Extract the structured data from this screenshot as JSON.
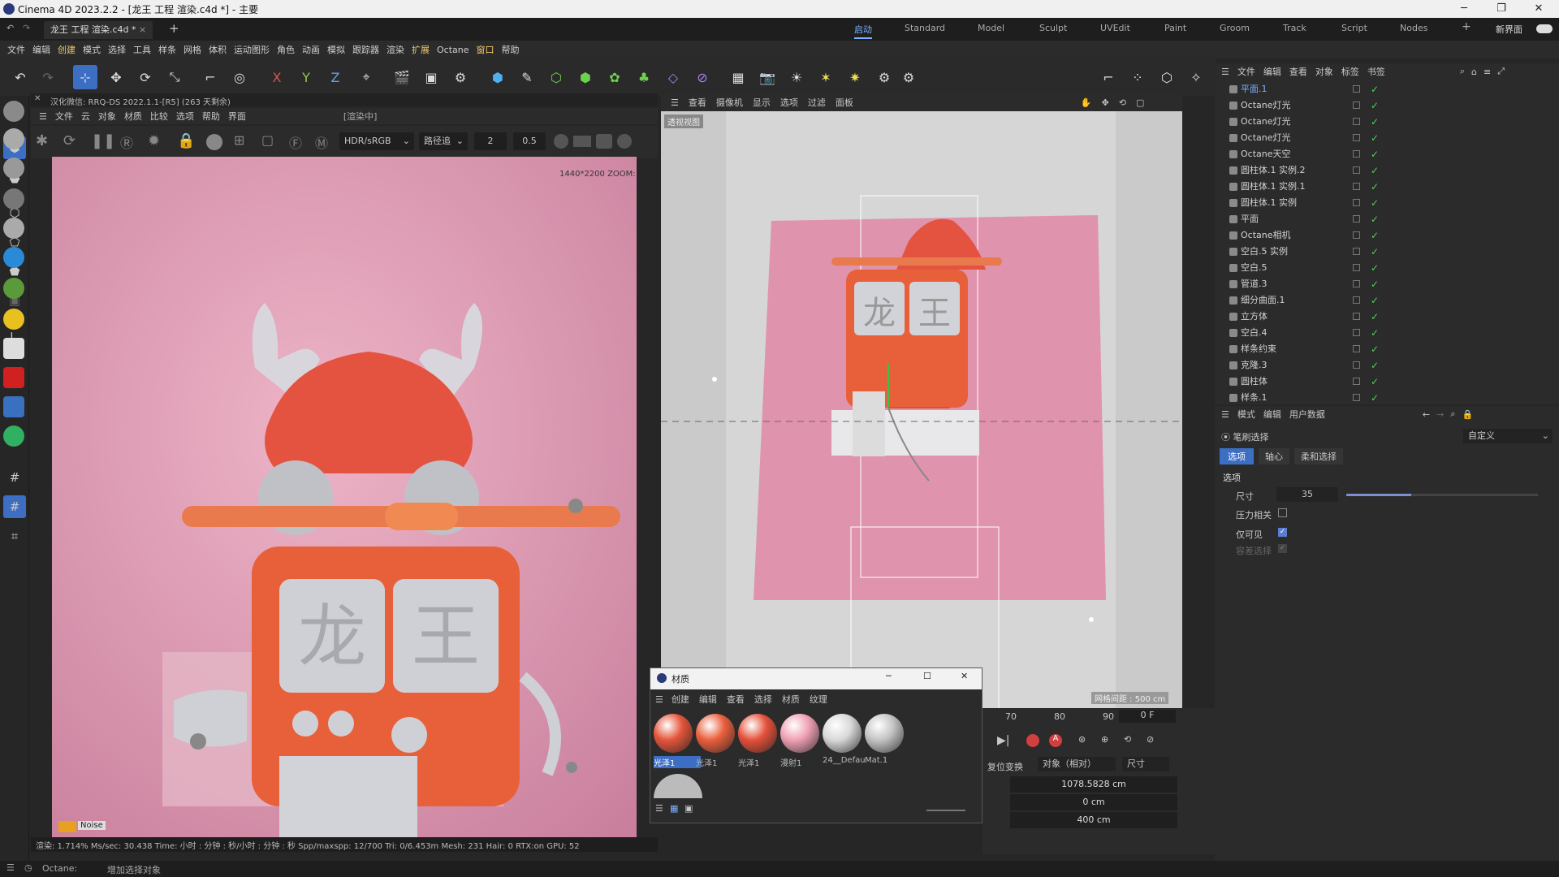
{
  "window": {
    "title": "Cinema 4D 2023.2.2 - [龙王 工程 渲染.c4d *] - 主要"
  },
  "tabs": {
    "document": "龙王 工程 渲染.c4d *",
    "new_tab": "+"
  },
  "layouts": [
    "启动",
    "Standard",
    "Model",
    "Sculpt",
    "UVEdit",
    "Paint",
    "Groom",
    "Track",
    "Script",
    "Nodes"
  ],
  "layout_extra": {
    "add": "+",
    "new_ui": "新界面"
  },
  "menu": [
    "文件",
    "编辑",
    "创建",
    "模式",
    "选择",
    "工具",
    "样条",
    "网格",
    "体积",
    "运动图形",
    "角色",
    "动画",
    "模拟",
    "跟踪器",
    "渲染",
    "扩展",
    "Octane",
    "窗口",
    "帮助"
  ],
  "toolbar_axes": [
    "X",
    "Y",
    "Z"
  ],
  "render_viewer": {
    "header": "汉化微信: RRQ-DS  2022.1.1-[R5] (263 天剩余)",
    "status_label": "[渲染中]",
    "menu": [
      "文件",
      "云",
      "对象",
      "材质",
      "比较",
      "选项",
      "帮助",
      "界面"
    ],
    "color_mode": "HDR/sRGB",
    "kernel": "路径追",
    "value_a": "2",
    "value_b": "0.5",
    "zoom_info": "1440*2200 ZOOM:",
    "label_noise": "Noise",
    "status_bar": "渲染: 1.714%  Ms/sec: 30.438  Time: 小时 : 分钟 : 秒/小时 : 分钟 : 秒  Spp/maxspp: 12/700  Tri: 0/6.453m  Mesh: 231  Hair: 0  RTX:on   GPU: 52",
    "render_text": [
      "龙",
      "王"
    ]
  },
  "viewport": {
    "menu": [
      "查看",
      "摄像机",
      "显示",
      "选项",
      "过滤",
      "面板"
    ],
    "label": "透视视图",
    "grid_info": "网格间距 : 500 cm",
    "chars": [
      "龙",
      "王"
    ]
  },
  "object_manager": {
    "menu": [
      "文件",
      "编辑",
      "查看",
      "对象",
      "标签",
      "书签"
    ],
    "objects": [
      {
        "name": "平面.1",
        "highlight": true
      },
      {
        "name": "Octane灯光"
      },
      {
        "name": "Octane灯光"
      },
      {
        "name": "Octane灯光"
      },
      {
        "name": "Octane天空"
      },
      {
        "name": "圆柱体.1 实例.2"
      },
      {
        "name": "圆柱体.1 实例.1"
      },
      {
        "name": "圆柱体.1 实例"
      },
      {
        "name": "平面"
      },
      {
        "name": "Octane相机"
      },
      {
        "name": "空白.5 实例"
      },
      {
        "name": "空白.5"
      },
      {
        "name": "管道.3"
      },
      {
        "name": "细分曲面.1"
      },
      {
        "name": "立方体"
      },
      {
        "name": "空白.4"
      },
      {
        "name": "样条约束"
      },
      {
        "name": "克隆.3"
      },
      {
        "name": "圆柱体"
      },
      {
        "name": "样条.1"
      }
    ]
  },
  "attributes": {
    "menu": [
      "模式",
      "编辑",
      "用户数据"
    ],
    "title": "笔刷选择",
    "preset": "自定义",
    "tabs": [
      "选项",
      "轴心",
      "柔和选择"
    ],
    "section": "选项",
    "size_label": "尺寸",
    "size_value": "35",
    "size_fraction": 0.34,
    "pressure_label": "压力相关",
    "visible_only_label": "仅可见",
    "tolerant_label": "容差选择"
  },
  "material_window": {
    "title": "材质",
    "menu": [
      "创建",
      "编辑",
      "查看",
      "选择",
      "材质",
      "纹理"
    ],
    "materials": [
      {
        "name": "光泽1",
        "color": "#e4553a",
        "selected": true
      },
      {
        "name": "光泽1",
        "color": "#ea5f3c"
      },
      {
        "name": "光泽1",
        "color": "#e4503a"
      },
      {
        "name": "漫射1",
        "color": "#f0a0b4"
      },
      {
        "name": "24__Defau",
        "color": "#d8d8d8"
      },
      {
        "name": "Mat.1",
        "color": "#c4c4c4"
      }
    ]
  },
  "timeline": {
    "ticks": [
      "70",
      "80",
      "90"
    ],
    "frame": "0 F",
    "coord_mode_reset": "复位变换",
    "coord_mode": "对象（相对）",
    "size_mode": "尺寸",
    "values": [
      "1078.5828 cm",
      "0 cm",
      "400 cm"
    ]
  },
  "statusbar": {
    "left": "Octane:",
    "hint": "增加选择对象"
  },
  "colors": {
    "accent": "#7db0ff",
    "check": "#4ed44e",
    "orange": "#e8603a",
    "pink_bg": "#de99b4"
  }
}
